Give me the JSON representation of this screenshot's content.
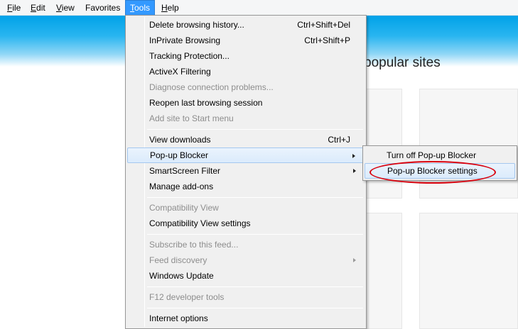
{
  "menubar": {
    "items": [
      {
        "label": "File",
        "key": "F",
        "rest": "ile"
      },
      {
        "label": "Edit",
        "key": "E",
        "rest": "dit"
      },
      {
        "label": "View",
        "key": "V",
        "rest": "iew"
      },
      {
        "label": "Favorites",
        "key": "",
        "rest": "Favorites"
      },
      {
        "label": "Tools",
        "key": "T",
        "rest": "ools"
      },
      {
        "label": "Help",
        "key": "H",
        "rest": "elp"
      }
    ]
  },
  "page": {
    "frequent_title": "popular sites"
  },
  "tools_menu": {
    "items": [
      {
        "label": "Delete browsing history...",
        "shortcut": "Ctrl+Shift+Del",
        "enabled": true
      },
      {
        "label": "InPrivate Browsing",
        "shortcut": "Ctrl+Shift+P",
        "enabled": true
      },
      {
        "label": "Tracking Protection...",
        "shortcut": "",
        "enabled": true
      },
      {
        "label": "ActiveX Filtering",
        "shortcut": "",
        "enabled": true
      },
      {
        "label": "Diagnose connection problems...",
        "shortcut": "",
        "enabled": false
      },
      {
        "label": "Reopen last browsing session",
        "shortcut": "",
        "enabled": true
      },
      {
        "label": "Add site to Start menu",
        "shortcut": "",
        "enabled": false
      },
      {
        "label": "View downloads",
        "shortcut": "Ctrl+J",
        "enabled": true
      },
      {
        "label": "Pop-up Blocker",
        "shortcut": "",
        "enabled": true,
        "submenu": true
      },
      {
        "label": "SmartScreen Filter",
        "shortcut": "",
        "enabled": true,
        "submenu": true
      },
      {
        "label": "Manage add-ons",
        "shortcut": "",
        "enabled": true
      },
      {
        "label": "Compatibility View",
        "shortcut": "",
        "enabled": false
      },
      {
        "label": "Compatibility View settings",
        "shortcut": "",
        "enabled": true
      },
      {
        "label": "Subscribe to this feed...",
        "shortcut": "",
        "enabled": false
      },
      {
        "label": "Feed discovery",
        "shortcut": "",
        "enabled": false,
        "submenu": true
      },
      {
        "label": "Windows Update",
        "shortcut": "",
        "enabled": true
      },
      {
        "label": "F12 developer tools",
        "shortcut": "",
        "enabled": false
      },
      {
        "label": "Internet options",
        "shortcut": "",
        "enabled": true
      }
    ]
  },
  "popup_submenu": {
    "items": [
      {
        "label": "Turn off Pop-up Blocker"
      },
      {
        "label": "Pop-up Blocker settings"
      }
    ]
  },
  "colors": {
    "menu_highlight": "#3399ff",
    "annotation": "#d9000c",
    "sky": "#00a2e8"
  }
}
